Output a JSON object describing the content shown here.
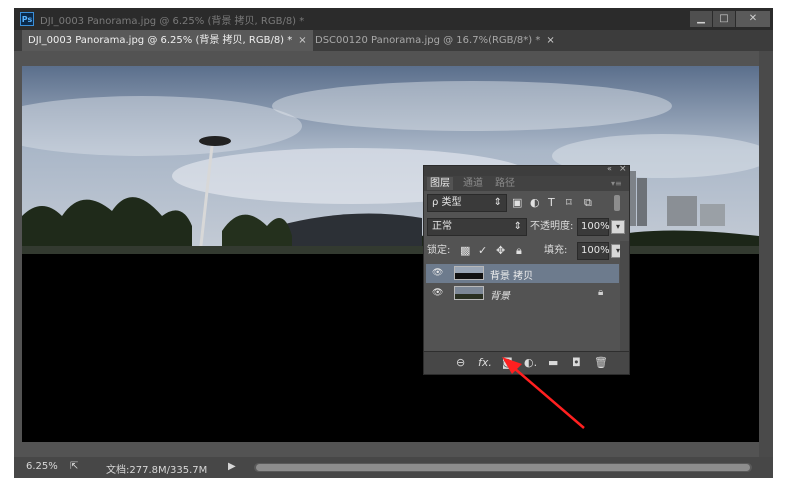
{
  "window": {
    "title": "DJI_0003 Panorama.jpg @ 6.25% (背景 拷贝, RGB/8) *",
    "app_icon": "Ps",
    "controls": [
      "minimize-icon",
      "maximize-icon",
      "close-icon"
    ]
  },
  "tabs": [
    {
      "label": "DJI_0003 Panorama.jpg @ 6.25% (背景 拷贝, RGB/8) *",
      "close": "×",
      "active": true
    },
    {
      "label": "DSC00120 Panorama.jpg @ 16.7%(RGB/8*) *",
      "close": "×",
      "active": false
    }
  ],
  "status": {
    "zoom": "6.25%",
    "doc_info": "文档:277.8M/335.7M",
    "arrow": "▶"
  },
  "layers_panel": {
    "collapse": "«",
    "close": "×",
    "menu": "▾≡",
    "tabs": [
      {
        "label": "图层",
        "active": true
      },
      {
        "label": "通道",
        "active": false
      },
      {
        "label": "路径",
        "active": false
      }
    ],
    "filter": {
      "label": "ρ 类型",
      "arrow": "⇕",
      "filter_icons": [
        "image-icon",
        "adjustment-icon",
        "type-icon",
        "shape-icon",
        "smart-object-icon"
      ]
    },
    "blend_mode": {
      "value": "正常",
      "arrow": "⇕"
    },
    "opacity": {
      "label": "不透明度:",
      "value": "100%"
    },
    "lock": {
      "label": "锁定:",
      "icons": [
        "lock-pixels-icon",
        "brush-icon",
        "move-icon",
        "lock-icon"
      ]
    },
    "fill": {
      "label": "填充:",
      "value": "100%"
    },
    "layers": [
      {
        "name": "背景 拷贝",
        "selected": true,
        "locked": false
      },
      {
        "name": "背景",
        "selected": false,
        "locked": true
      }
    ],
    "bottom_icons": [
      "link-icon",
      "fx-icon",
      "mask-icon",
      "adjustment-layer-icon",
      "folder-icon",
      "new-layer-icon",
      "trash-icon"
    ]
  },
  "colors": {
    "arrow": "#ff2020",
    "selected_layer": "#6d7b8d",
    "panel_bg": "#535353"
  }
}
